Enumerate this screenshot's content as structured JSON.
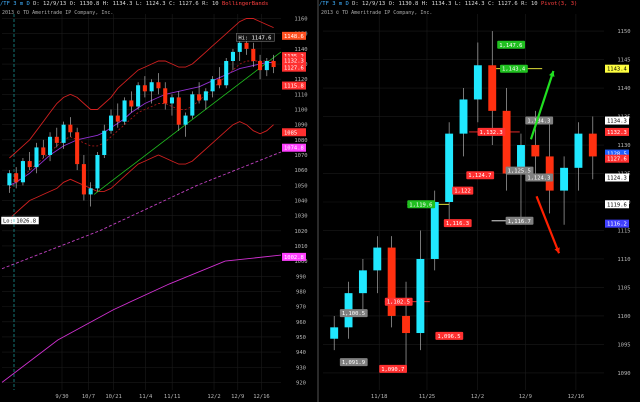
{
  "chart_data": [
    {
      "type": "candlestick",
      "panel": "left",
      "header": {
        "symbol": "/TF 3 m D",
        "date": "D: 12/9/13",
        "open": "O: 1130.8",
        "high": "H: 1134.3",
        "low": "L: 1124.3",
        "close": "C: 1127.6",
        "range": "R: 10",
        "study": "BollingerBands"
      },
      "copyright": "2013 © TD Ameritrade IP Company, Inc.",
      "ylim": [
        915,
        1163
      ],
      "yticks": [
        920,
        930,
        940,
        950,
        960,
        970,
        980,
        990,
        1000,
        1010,
        1020,
        1030,
        1040,
        1050,
        1060,
        1070,
        1080,
        1090,
        1100,
        1110,
        1120,
        1130,
        1140,
        1150,
        1160
      ],
      "xticks": [
        "9/30",
        "10/7",
        "10/21",
        "11/4",
        "11/11",
        "12/2",
        "12/9",
        "12/16"
      ],
      "xtick_frac": [
        0.215,
        0.31,
        0.4,
        0.515,
        0.61,
        0.76,
        0.845,
        0.93
      ],
      "candles": [
        [
          1050,
          1060,
          1045,
          1058
        ],
        [
          1058,
          1062,
          1048,
          1052
        ],
        [
          1052,
          1068,
          1050,
          1066
        ],
        [
          1066,
          1072,
          1060,
          1062
        ],
        [
          1062,
          1078,
          1058,
          1075
        ],
        [
          1075,
          1080,
          1068,
          1070
        ],
        [
          1070,
          1085,
          1066,
          1082
        ],
        [
          1082,
          1088,
          1075,
          1078
        ],
        [
          1078,
          1092,
          1074,
          1090
        ],
        [
          1090,
          1095,
          1082,
          1085
        ],
        [
          1085,
          1088,
          1060,
          1064
        ],
        [
          1064,
          1070,
          1040,
          1044
        ],
        [
          1044,
          1052,
          1036,
          1048
        ],
        [
          1048,
          1072,
          1046,
          1070
        ],
        [
          1070,
          1090,
          1068,
          1086
        ],
        [
          1086,
          1100,
          1084,
          1096
        ],
        [
          1096,
          1104,
          1088,
          1092
        ],
        [
          1092,
          1108,
          1090,
          1106
        ],
        [
          1106,
          1112,
          1098,
          1102
        ],
        [
          1102,
          1118,
          1100,
          1116
        ],
        [
          1116,
          1122,
          1108,
          1112
        ],
        [
          1112,
          1120,
          1104,
          1118
        ],
        [
          1118,
          1124,
          1110,
          1114
        ],
        [
          1114,
          1118,
          1100,
          1104
        ],
        [
          1104,
          1110,
          1096,
          1108
        ],
        [
          1108,
          1112,
          1086,
          1090
        ],
        [
          1090,
          1098,
          1082,
          1096
        ],
        [
          1096,
          1112,
          1094,
          1110
        ],
        [
          1110,
          1118,
          1104,
          1106
        ],
        [
          1106,
          1114,
          1100,
          1112
        ],
        [
          1112,
          1122,
          1108,
          1120
        ],
        [
          1120,
          1128,
          1114,
          1116
        ],
        [
          1116,
          1134,
          1114,
          1132
        ],
        [
          1132,
          1140,
          1126,
          1138
        ],
        [
          1138,
          1146,
          1132,
          1144
        ],
        [
          1144,
          1148,
          1136,
          1140
        ],
        [
          1140,
          1144,
          1128,
          1132
        ],
        [
          1132,
          1136,
          1120,
          1126
        ],
        [
          1126,
          1134,
          1122,
          1132
        ],
        [
          1132,
          1136,
          1124,
          1128
        ]
      ],
      "bands": {
        "upper": [
          1068,
          1072,
          1076,
          1080,
          1086,
          1092,
          1098,
          1104,
          1108,
          1110,
          1108,
          1104,
          1100,
          1100,
          1104,
          1108,
          1114,
          1118,
          1122,
          1126,
          1128,
          1130,
          1132,
          1132,
          1130,
          1128,
          1128,
          1130,
          1134,
          1138,
          1142,
          1146,
          1150,
          1154,
          1158,
          1160,
          1160,
          1158,
          1156,
          1154
        ],
        "middle": [
          1048,
          1052,
          1056,
          1060,
          1064,
          1068,
          1072,
          1076,
          1080,
          1082,
          1080,
          1078,
          1076,
          1076,
          1078,
          1082,
          1086,
          1090,
          1094,
          1098,
          1100,
          1102,
          1104,
          1104,
          1102,
          1100,
          1100,
          1102,
          1106,
          1110,
          1114,
          1118,
          1122,
          1126,
          1130,
          1132,
          1132,
          1132,
          1132,
          1132
        ],
        "lower": [
          1028,
          1032,
          1036,
          1040,
          1042,
          1044,
          1046,
          1048,
          1052,
          1054,
          1052,
          1050,
          1048,
          1046,
          1046,
          1048,
          1052,
          1056,
          1060,
          1064,
          1066,
          1068,
          1070,
          1068,
          1066,
          1064,
          1064,
          1066,
          1070,
          1074,
          1078,
          1082,
          1086,
          1090,
          1092,
          1090,
          1086,
          1084,
          1086,
          1090
        ]
      },
      "ma_purple": [
        1050,
        1052,
        1055,
        1058,
        1062,
        1066,
        1070,
        1073,
        1076,
        1078,
        1080,
        1081,
        1082,
        1083,
        1085,
        1088,
        1091,
        1094,
        1098,
        1101,
        1104,
        1106,
        1108,
        1110,
        1111,
        1112,
        1113,
        1114,
        1115,
        1117,
        1119,
        1121,
        1123,
        1125,
        1127,
        1128,
        1129,
        1130,
        1131,
        1131
      ],
      "magenta_line": {
        "x": [
          0,
          0.2,
          0.4,
          0.6,
          0.8,
          1.0
        ],
        "y": [
          920,
          948,
          968,
          985,
          1000,
          1004
        ]
      },
      "dashed_line": {
        "x": [
          0,
          0.35,
          0.7,
          1.0
        ],
        "y": [
          995,
          1020,
          1050,
          1072
        ]
      },
      "trendline": {
        "x": [
          0.33,
          1.0
        ],
        "y": [
          1044,
          1138
        ]
      },
      "labels": [
        {
          "text": "Hi: 1147.6",
          "price": 1147.6,
          "bg": "#101010",
          "fg": "#ffffff",
          "border": "#888"
        },
        {
          "text": "Lo: 1026.8",
          "price": 1026.8,
          "bg": "#ffffff",
          "fg": "#000000",
          "border": "#000"
        }
      ],
      "right_labels": [
        {
          "text": "1148.6",
          "price": 1148.6,
          "bg": "#ff5020"
        },
        {
          "text": "1135.2",
          "price": 1135.2,
          "bg": "#ff3030"
        },
        {
          "text": "1132.3",
          "price": 1132.3,
          "bg": "#ff3030"
        },
        {
          "text": "1127.6",
          "price": 1127.6,
          "bg": "#ff3030"
        },
        {
          "text": "1115.8",
          "price": 1115.8,
          "bg": "#ff3030"
        },
        {
          "text": "1085",
          "price": 1085,
          "bg": "#ff3030"
        },
        {
          "text": "1074.8",
          "price": 1074.8,
          "bg": "#ff40ff"
        },
        {
          "text": "1002.8",
          "price": 1002.8,
          "bg": "#ff40ff"
        }
      ]
    },
    {
      "type": "candlestick",
      "panel": "right",
      "header": {
        "symbol": "/TF 3 m D",
        "date": "D: 12/9/13",
        "open": "O: 1130.8",
        "high": "H: 1134.3",
        "low": "L: 1124.3",
        "close": "C: 1127.6",
        "range": "R: 10",
        "study": "Pivot(3, 3)"
      },
      "copyright": "2013 © TD Ameritrade IP Company, Inc.",
      "ylim": [
        1087,
        1153
      ],
      "yticks": [
        1090,
        1095,
        1100,
        1105,
        1110,
        1115,
        1120,
        1125,
        1130,
        1135,
        1140,
        1145,
        1150
      ],
      "xticks": [
        "11/18",
        "11/25",
        "12/2",
        "12/9",
        "12/16"
      ],
      "xtick_frac": [
        0.2,
        0.37,
        0.55,
        0.72,
        0.9
      ],
      "candles": [
        [
          1096,
          1100,
          1094,
          1098
        ],
        [
          1098,
          1106,
          1096,
          1104
        ],
        [
          1104,
          1110,
          1100,
          1108
        ],
        [
          1108,
          1114,
          1104,
          1112
        ],
        [
          1112,
          1114,
          1098,
          1100
        ],
        [
          1100,
          1106,
          1090,
          1097
        ],
        [
          1097,
          1115,
          1094,
          1110
        ],
        [
          1110,
          1122,
          1108,
          1120
        ],
        [
          1120,
          1134,
          1116,
          1132
        ],
        [
          1132,
          1140,
          1128,
          1138
        ],
        [
          1138,
          1148,
          1134,
          1144
        ],
        [
          1144,
          1150,
          1130,
          1136
        ],
        [
          1136,
          1140,
          1122,
          1125
        ],
        [
          1125,
          1132,
          1116,
          1130
        ],
        [
          1130,
          1136,
          1124,
          1128
        ],
        [
          1128,
          1134,
          1118,
          1122
        ],
        [
          1122,
          1128,
          1116,
          1126
        ],
        [
          1126,
          1134,
          1122,
          1132
        ],
        [
          1132,
          1135,
          1124,
          1128
        ]
      ],
      "hlines": [
        {
          "price": 1143.4,
          "color": "#ffff40",
          "x": [
            0.6,
            0.78
          ]
        },
        {
          "price": 1119.6,
          "color": "#ffff40",
          "x": [
            0.3,
            0.45
          ]
        },
        {
          "price": 1132.3,
          "color": "#ff3030",
          "x": [
            0.52,
            0.7
          ]
        },
        {
          "price": 1116.7,
          "color": "#ffffff",
          "x": [
            0.6,
            0.72
          ]
        },
        {
          "price": 1102.5,
          "color": "#ff3030",
          "x": [
            0.22,
            0.38
          ]
        }
      ],
      "pivot_labels": [
        {
          "text": "1,147.6",
          "price": 1147.6,
          "bg": "#20c020",
          "fg": "#ffffff",
          "xf": 0.62
        },
        {
          "text": "1,143.4",
          "price": 1143.4,
          "bg": "#20c020",
          "fg": "#ffffff",
          "xf": 0.63
        },
        {
          "text": "1,134.3",
          "price": 1134.3,
          "bg": "#808080",
          "fg": "#ffffff",
          "xf": 0.72
        },
        {
          "text": "1,132.3",
          "price": 1132.3,
          "bg": "#ff3030",
          "fg": "#ffffff",
          "xf": 0.55
        },
        {
          "text": "1,125.5",
          "price": 1125.5,
          "bg": "#808080",
          "fg": "#ffffff",
          "xf": 0.65
        },
        {
          "text": "1,124.7",
          "price": 1124.7,
          "bg": "#ff3030",
          "fg": "#ffffff",
          "xf": 0.51
        },
        {
          "text": "1,124.3",
          "price": 1124.3,
          "bg": "#808080",
          "fg": "#ffffff",
          "xf": 0.72
        },
        {
          "text": "1,122",
          "price": 1122,
          "bg": "#ff3030",
          "fg": "#ffffff",
          "xf": 0.46
        },
        {
          "text": "1,119.6",
          "price": 1119.6,
          "bg": "#20c020",
          "fg": "#ffffff",
          "xf": 0.3
        },
        {
          "text": "1,116.7",
          "price": 1116.7,
          "bg": "#808080",
          "fg": "#ffffff",
          "xf": 0.65
        },
        {
          "text": "1,116.3",
          "price": 1116.3,
          "bg": "#ff3030",
          "fg": "#ffffff",
          "xf": 0.43
        },
        {
          "text": "1,102.5",
          "price": 1102.5,
          "bg": "#ff3030",
          "fg": "#ffffff",
          "xf": 0.22
        },
        {
          "text": "1,100.5",
          "price": 1100.5,
          "bg": "#808080",
          "fg": "#ffffff",
          "xf": 0.06
        },
        {
          "text": "1,096.5",
          "price": 1096.5,
          "bg": "#ff3030",
          "fg": "#ffffff",
          "xf": 0.4
        },
        {
          "text": "1,091.9",
          "price": 1091.9,
          "bg": "#808080",
          "fg": "#ffffff",
          "xf": 0.06
        },
        {
          "text": "1,090.7",
          "price": 1090.7,
          "bg": "#ff3030",
          "fg": "#ffffff",
          "xf": 0.2
        }
      ],
      "right_labels": [
        {
          "text": "1143.4",
          "price": 1143.4,
          "bg": "#ffff40",
          "fg": "#000"
        },
        {
          "text": "1134.3",
          "price": 1134.3,
          "bg": "#ffffff",
          "fg": "#000"
        },
        {
          "text": "1132.3",
          "price": 1132.3,
          "bg": "#ff3030",
          "fg": "#fff"
        },
        {
          "text": "1128.5",
          "price": 1128.5,
          "bg": "#2060ff",
          "fg": "#fff"
        },
        {
          "text": "1127.6",
          "price": 1127.6,
          "bg": "#ff3030",
          "fg": "#fff"
        },
        {
          "text": "1124.3",
          "price": 1124.3,
          "bg": "#ffffff",
          "fg": "#000"
        },
        {
          "text": "1119.6",
          "price": 1119.6,
          "bg": "#ffffff",
          "fg": "#000"
        },
        {
          "text": "1116.2",
          "price": 1116.2,
          "bg": "#4040ff",
          "fg": "#fff"
        }
      ],
      "arrows": [
        {
          "color": "#20e020",
          "from": [
            0.74,
            1131
          ],
          "to": [
            0.82,
            1143
          ]
        },
        {
          "color": "#ff2000",
          "from": [
            0.76,
            1121
          ],
          "to": [
            0.84,
            1111
          ]
        }
      ]
    }
  ]
}
